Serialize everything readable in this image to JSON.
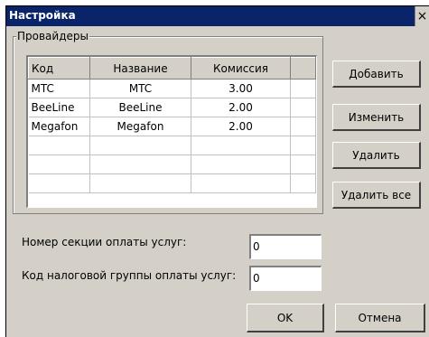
{
  "window": {
    "title": "Настройка",
    "close_glyph": "×"
  },
  "providers": {
    "group_label": "Провайдеры",
    "columns": [
      "Код",
      "Название",
      "Комиссия",
      ""
    ],
    "rows": [
      [
        "MTC",
        "MTC",
        "3.00",
        ""
      ],
      [
        "BeeLine",
        "BeeLine",
        "2.00",
        ""
      ],
      [
        "Megafon",
        "Megafon",
        "2.00",
        ""
      ],
      [
        "",
        "",
        "",
        ""
      ],
      [
        "",
        "",
        "",
        ""
      ],
      [
        "",
        "",
        "",
        ""
      ]
    ]
  },
  "buttons": {
    "add": "Добавить",
    "edit": "Изменить",
    "delete": "Удалить",
    "delete_all": "Удалить все",
    "ok": "OK",
    "cancel": "Отмена"
  },
  "fields": {
    "section_label": "Номер секции оплаты услуг:",
    "section_value": "0",
    "tax_label": "Код налоговой группы оплаты услуг:",
    "tax_value": "0"
  }
}
